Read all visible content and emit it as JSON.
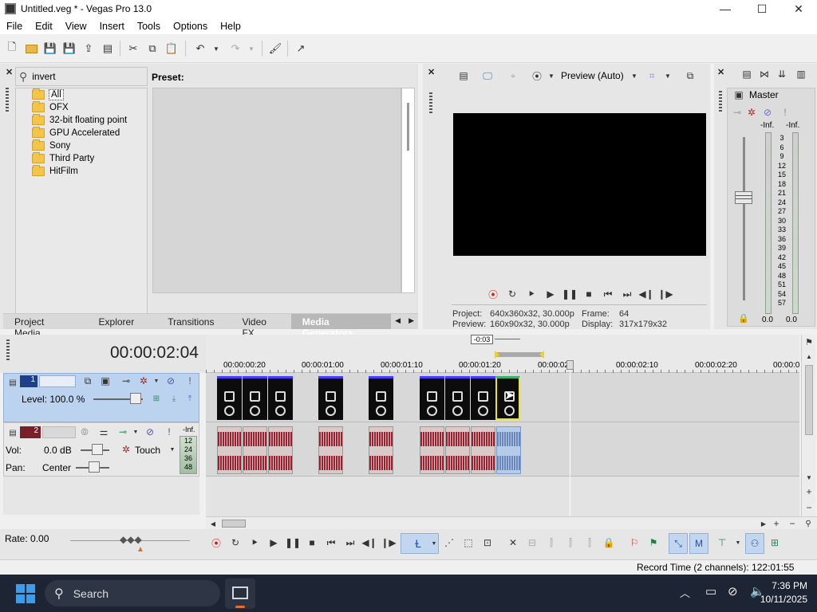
{
  "window": {
    "title": "Untitled.veg * - Vegas Pro 13.0",
    "minimize": "—",
    "maximize": "☐",
    "close": "✕"
  },
  "menu": [
    "File",
    "Edit",
    "View",
    "Insert",
    "Tools",
    "Options",
    "Help"
  ],
  "explorer": {
    "search_value": "invert",
    "preset_label": "Preset:",
    "tree": [
      "All",
      "OFX",
      "32-bit floating point",
      "GPU Accelerated",
      "Sony",
      "Third Party",
      "HitFilm"
    ]
  },
  "tabs": [
    "Project Media",
    "Explorer",
    "Transitions",
    "Video FX",
    "Media Generators"
  ],
  "preview": {
    "mode": "Preview (Auto)",
    "project_label": "Project:",
    "project_value": "640x360x32, 30.000p",
    "preview_label": "Preview:",
    "preview_value": "160x90x32, 30.000p",
    "frame_label": "Frame:",
    "frame_value": "64",
    "display_label": "Display:",
    "display_value": "317x179x32"
  },
  "master": {
    "label": "Master",
    "inf_left": "-Inf.",
    "inf_right": "-Inf.",
    "scale": [
      "3",
      "6",
      "9",
      "12",
      "15",
      "18",
      "21",
      "24",
      "27",
      "30",
      "33",
      "36",
      "39",
      "42",
      "45",
      "48",
      "51",
      "54",
      "57"
    ],
    "bottom_left": "0.0",
    "bottom_right": "0.0"
  },
  "timeline": {
    "timecode": "00:00:02:04",
    "marker_label": "-0:03",
    "ruler": [
      "00:00:00:20",
      "00:00:01:00",
      "00:00:01:10",
      "00:00:01:20",
      "00:00:02",
      "00:00:02:10",
      "00:00:02:20",
      "00:00:0"
    ]
  },
  "track1": {
    "number": "1",
    "level": "Level: 100.0 %"
  },
  "track2": {
    "number": "2",
    "vol_label": "Vol:",
    "vol_value": "0.0 dB",
    "pan_label": "Pan:",
    "pan_value": "Center",
    "mode": "Touch",
    "inf": "-Inf.",
    "meter_ticks": [
      "12",
      "24",
      "36",
      "48"
    ]
  },
  "transport": {
    "rate": "Rate: 0.00"
  },
  "status": {
    "record_time": "Record Time (2 channels): 122:01:55"
  },
  "taskbar": {
    "search": "Search",
    "time": "7:36 PM",
    "date": "10/11/2025"
  },
  "colors": {
    "accent": "#3a6fd8",
    "video_track": "#bcd3ef",
    "audio_track": "#e8e8e8",
    "taskbar": "#1d2433"
  }
}
